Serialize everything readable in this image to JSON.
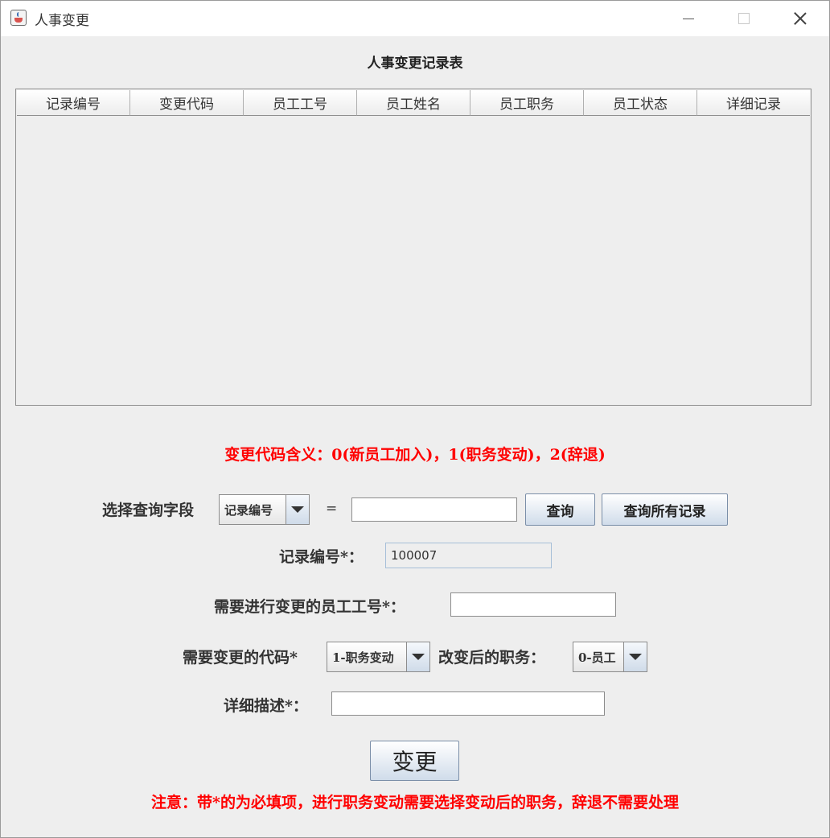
{
  "window": {
    "title": "人事变更"
  },
  "table": {
    "title": "人事变更记录表",
    "columns": [
      "记录编号",
      "变更代码",
      "员工工号",
      "员工姓名",
      "员工职务",
      "员工状态",
      "详细记录"
    ]
  },
  "notes": {
    "code_meaning": "变更代码含义：0(新员工加入)，1(职务变动)，2(辞退)",
    "attention": "注意：带*的为必填项，进行职务变动需要选择变动后的职务，辞退不需要处理"
  },
  "query": {
    "label": "选择查询字段",
    "field_selected": "记录编号",
    "equals": "=",
    "value": "",
    "query_button": "查询",
    "query_all_button": "查询所有记录"
  },
  "form": {
    "record_id_label": "记录编号*：",
    "record_id_value": "100007",
    "employee_id_label": "需要进行变更的员工工号*：",
    "employee_id_value": "",
    "change_code_label": "需要变更的代码*",
    "change_code_selected": "1-职务变动",
    "new_position_label": "改变后的职务：",
    "new_position_selected": "0-员工",
    "detail_label": "详细描述*：",
    "detail_value": "",
    "submit_button": "变更"
  }
}
